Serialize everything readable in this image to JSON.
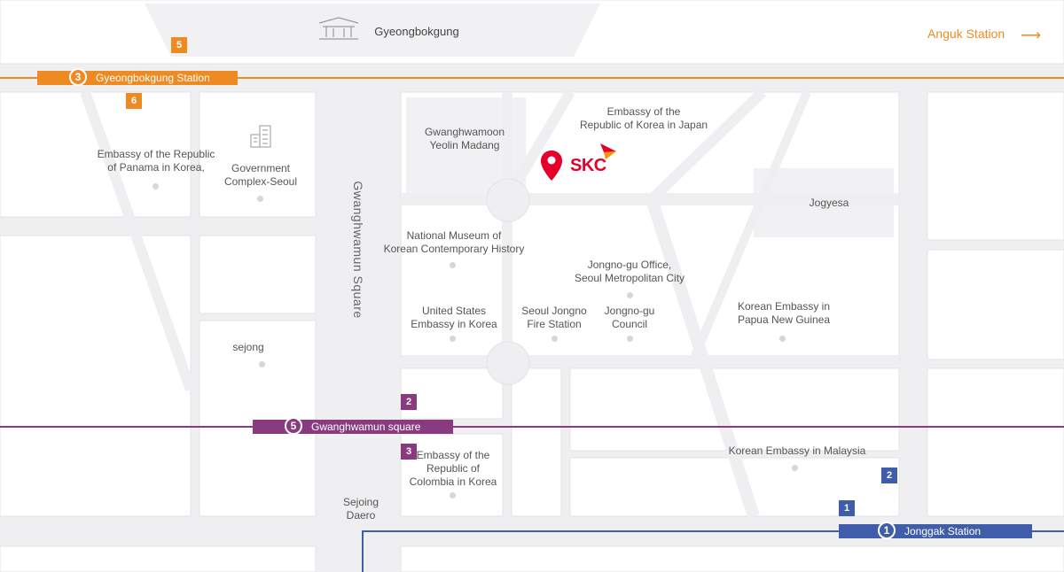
{
  "colors": {
    "line3": "#ee8a22",
    "line5": "#8a3b80",
    "line1": "#3f5da8",
    "pin": "#e4002b",
    "block": "#ffffff",
    "road": "#efeff1"
  },
  "top": {
    "landmark": "Gyeongbokgung",
    "landmark_icon": "palace-icon",
    "anguk": "Anguk Station",
    "arrow_icon": "arrow-right-icon"
  },
  "stations": {
    "line3": {
      "num": "3",
      "name": "Gyeongbokgung Station"
    },
    "line5": {
      "num": "5",
      "name": "Gwanghwamun square"
    },
    "line1": {
      "num": "1",
      "name": "Jonggak Station"
    }
  },
  "exits": {
    "e5_line3": "5",
    "e6_line3": "6",
    "e2_line5": "2",
    "e3_line5": "3",
    "e1_line1": "1",
    "e2_line1": "2"
  },
  "road": {
    "square": "Gwanghwamun Square",
    "sejong": "Sejoing\nDaero"
  },
  "skc": {
    "text": "SKC",
    "pin_icon": "location-pin-icon",
    "logo_icon": "skc-logo-icon"
  },
  "places": {
    "panama": "Embassy of the Republic\nof Panama in Korea,",
    "gov": "Government\nComplex-Seoul",
    "gov_icon": "building-icon",
    "yeolin": "Gwanghwamoon\nYeolin Madang",
    "japan": "Embassy of the\nRepublic of Korea in Japan",
    "jogyesa": "Jogyesa",
    "museum": "National Museum of\nKorean Contemporary History",
    "jongno_office": "Jongno-gu Office,\nSeoul Metropolitan City",
    "us": "United States\nEmbassy in Korea",
    "fire": "Seoul Jongno\nFire Station",
    "council": "Jongno-gu\nCouncil",
    "png": "Korean Embassy in\nPapua New Guinea",
    "sejong": "sejong",
    "colombia": "Embassy of the\nRepublic of\nColombia in Korea",
    "malaysia": "Korean Embassy in Malaysia"
  }
}
